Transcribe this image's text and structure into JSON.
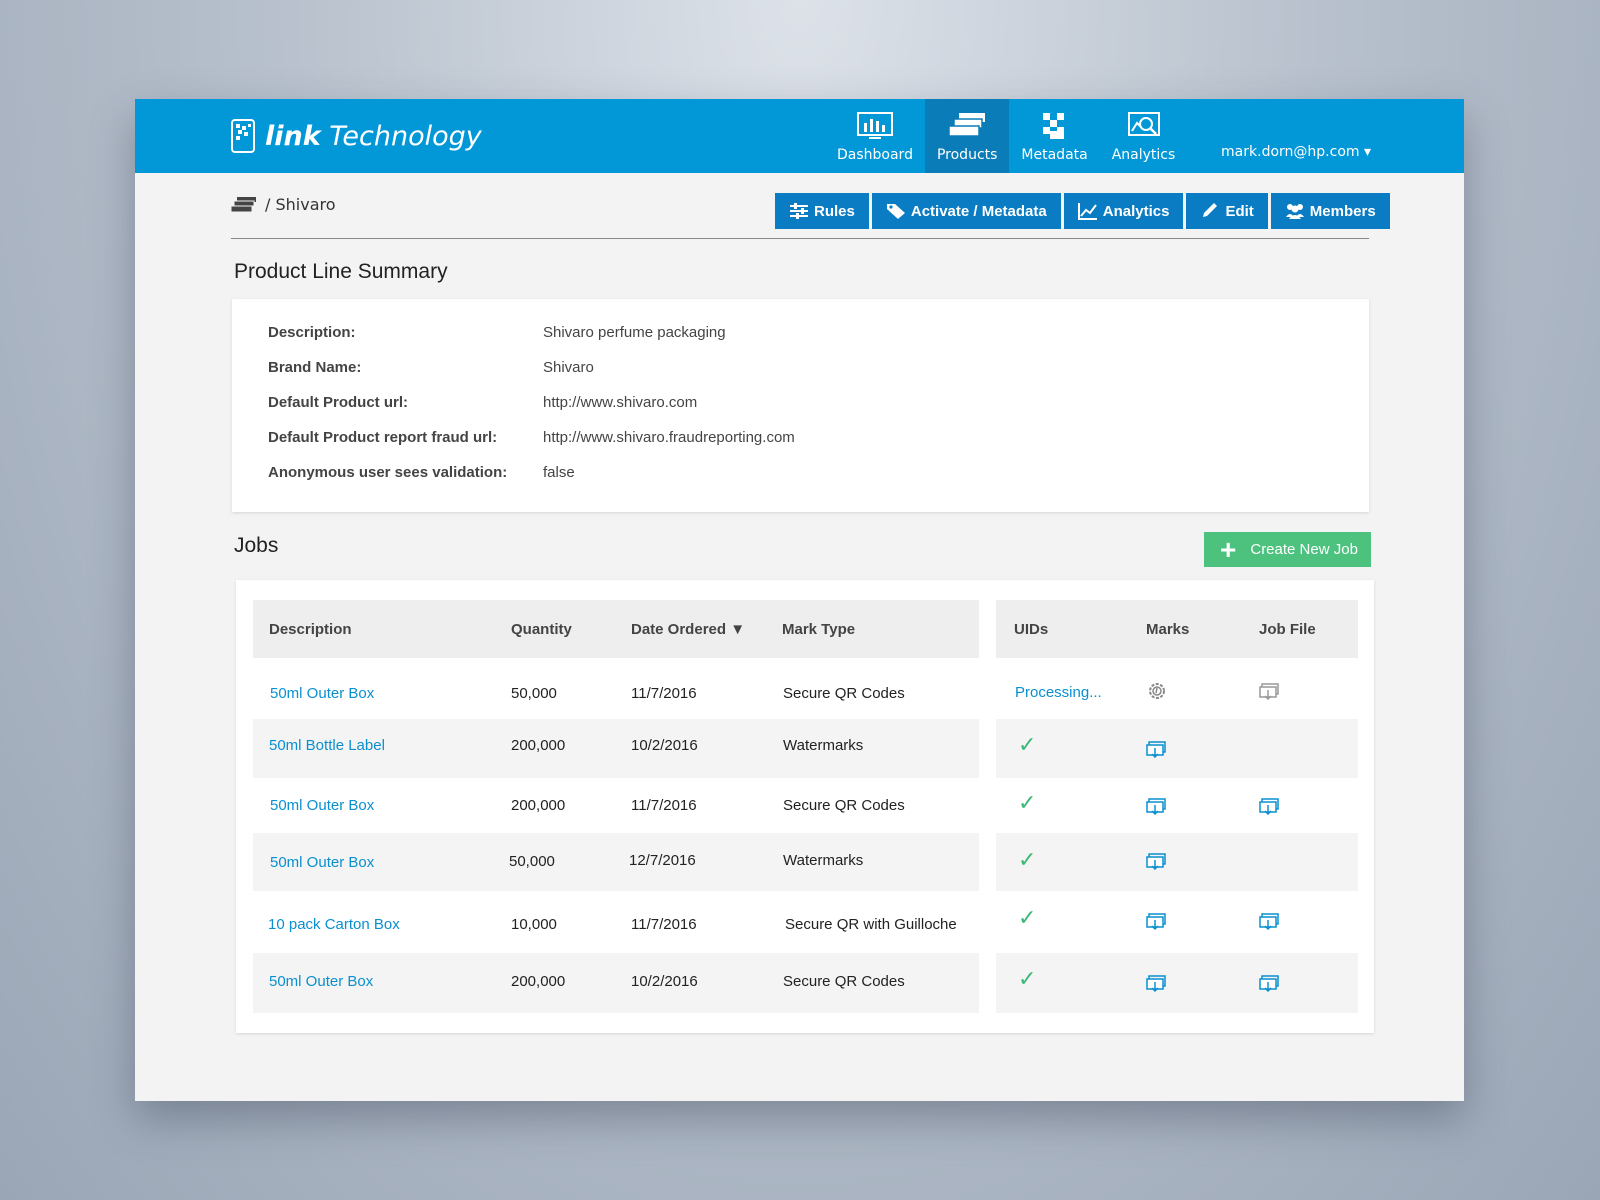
{
  "app": {
    "brand_bold": "link",
    "brand_rest": " Technology"
  },
  "nav": {
    "items": [
      {
        "label": "Dashboard",
        "icon": "dashboard-chart-icon"
      },
      {
        "label": "Products",
        "icon": "products-stack-icon",
        "active": true
      },
      {
        "label": "Metadata",
        "icon": "metadata-checker-icon"
      },
      {
        "label": "Analytics",
        "icon": "analytics-magnifier-icon"
      }
    ],
    "user": "mark.dorn@hp.com ▾"
  },
  "breadcrumb": {
    "separator": "/",
    "current": "Shivaro"
  },
  "actions": {
    "rules": "Rules",
    "activate": "Activate / Metadata",
    "analytics": "Analytics",
    "edit": "Edit",
    "members": "Members"
  },
  "summary": {
    "title": "Product Line Summary",
    "rows": [
      {
        "label": "Description:",
        "value": "Shivaro perfume packaging"
      },
      {
        "label": "Brand Name:",
        "value": "Shivaro"
      },
      {
        "label": "Default Product url:",
        "value": "http://www.shivaro.com"
      },
      {
        "label": "Default Product report fraud url:",
        "value": "http://www.shivaro.fraudreporting.com"
      },
      {
        "label": "Anonymous user sees validation:",
        "value": "false"
      }
    ]
  },
  "jobs": {
    "title": "Jobs",
    "create_label": "Create New Job",
    "headers": {
      "description": "Description",
      "quantity": "Quantity",
      "date": "Date Ordered ▼",
      "mark_type": "Mark Type",
      "uids": "UIDs",
      "marks": "Marks",
      "job_file": "Job File"
    },
    "rows": [
      {
        "description": "50ml Outer Box",
        "quantity": "50,000",
        "date": "11/7/2016",
        "mark_type": "Secure QR Codes",
        "uids": "Processing...",
        "marks": "processing-gear-icon",
        "job_file": "download-disabled-icon"
      },
      {
        "description": "50ml Bottle Label",
        "quantity": "200,000",
        "date": "10/2/2016",
        "mark_type": "Watermarks",
        "uids": "check-icon",
        "marks": "download-icon",
        "job_file": ""
      },
      {
        "description": "50ml Outer Box",
        "quantity": "200,000",
        "date": "11/7/2016",
        "mark_type": "Secure QR Codes",
        "uids": "check-icon",
        "marks": "download-icon",
        "job_file": "download-icon"
      },
      {
        "description": "50ml Outer Box",
        "quantity": "50,000",
        "date": "12/7/2016",
        "mark_type": "Watermarks",
        "uids": "check-icon",
        "marks": "download-icon",
        "job_file": ""
      },
      {
        "description": "10 pack Carton Box",
        "quantity": "10,000",
        "date": "11/7/2016",
        "mark_type": "Secure QR with Guilloche",
        "uids": "check-icon",
        "marks": "download-icon",
        "job_file": "download-icon"
      },
      {
        "description": "50ml Outer Box",
        "quantity": "200,000",
        "date": "10/2/2016",
        "mark_type": "Secure QR Codes",
        "uids": "check-icon",
        "marks": "download-icon",
        "job_file": "download-icon"
      }
    ]
  },
  "colors": {
    "primary": "#0298d8",
    "nav_active": "#0a7cb8",
    "button": "#0a7cc4",
    "create": "#4cc27e",
    "link": "#0a90d0",
    "check": "#3cb878"
  }
}
